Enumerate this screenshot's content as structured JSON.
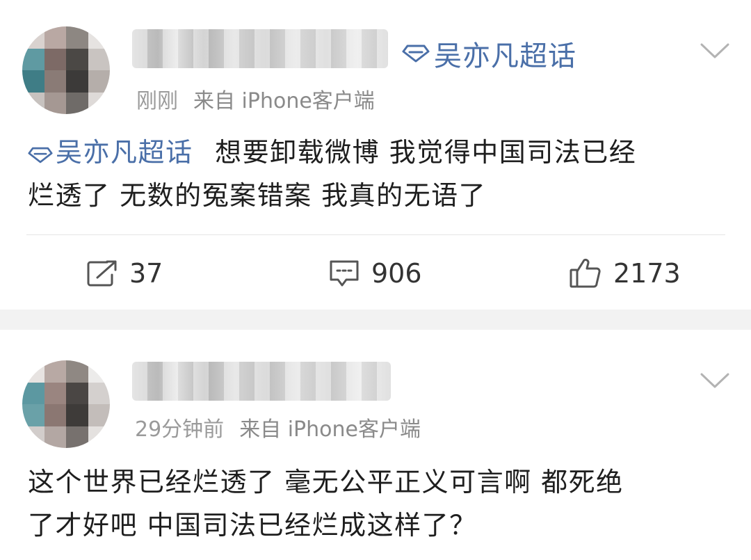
{
  "posts": [
    {
      "supertopic": "吴亦凡超话",
      "time": "刚刚",
      "source": "来自 iPhone客户端",
      "content_tag": "吴亦凡超话",
      "content_text_line1": "想要卸载微博 我觉得中国司法已经",
      "content_text_line2": "烂透了 无数的冤案错案   我真的无语了",
      "actions": {
        "repost_count": "37",
        "comment_count": "906",
        "like_count": "2173"
      },
      "icons": {
        "supertopic": "diamond-icon",
        "menu": "chevron-down-icon",
        "repost": "share-icon",
        "comment": "comment-icon",
        "like": "thumbs-up-icon"
      }
    },
    {
      "time": "29分钟前",
      "source": "来自 iPhone客户端",
      "content_line1": "这个世界已经烂透了 毫无公平正义可言啊  都死绝",
      "content_line2": "了才好吧  中国司法已经烂成这样了？",
      "icons": {
        "menu": "chevron-down-icon"
      }
    }
  ],
  "colors": {
    "link_blue": "#4a6fa8",
    "meta_gray": "#8a8a8a",
    "separator": "#f2f2f2"
  }
}
